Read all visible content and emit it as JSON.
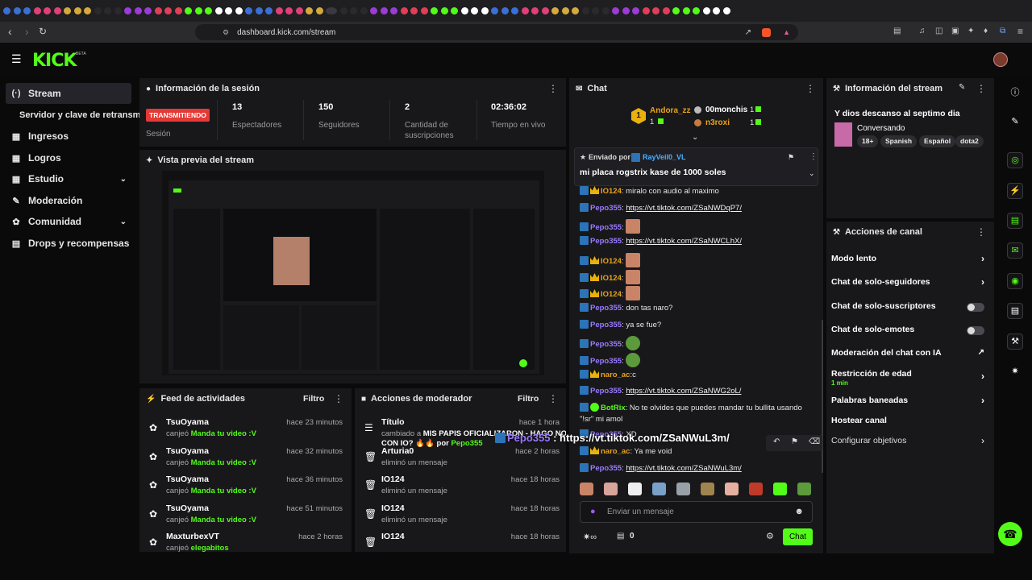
{
  "browser": {
    "url": "dashboard.kick.com/stream",
    "tab_count": 72
  },
  "app": {
    "logo": "KICK",
    "beta": "BETA"
  },
  "sidebar": {
    "items": [
      {
        "label": "Stream",
        "icon": "broadcast-icon",
        "active": true
      },
      {
        "label": "Servidor y clave de retransm",
        "icon": "",
        "sub": true
      },
      {
        "label": "Ingresos",
        "icon": "dollar-icon"
      },
      {
        "label": "Logros",
        "icon": "trophy-icon"
      },
      {
        "label": "Estudio",
        "icon": "studio-icon",
        "expand": true
      },
      {
        "label": "Moderación",
        "icon": "wrench-icon"
      },
      {
        "label": "Comunidad",
        "icon": "community-icon",
        "expand": true
      },
      {
        "label": "Drops y recompensas",
        "icon": "drops-icon"
      }
    ]
  },
  "session": {
    "title": "Información de la sesión",
    "live_badge": "TRANSMITIENDO",
    "live_label": "Sesión",
    "stats": [
      {
        "value": "13",
        "label": "Espectadores"
      },
      {
        "value": "150",
        "label": "Seguidores"
      },
      {
        "value": "2",
        "label": "Cantidad de suscripciones"
      },
      {
        "value": "02:36:02",
        "label": "Tiempo en vivo"
      }
    ]
  },
  "preview": {
    "title": "Vista previa del stream"
  },
  "feed": {
    "title": "Feed de actividades",
    "filter": "Filtro",
    "rows": [
      {
        "user": "TsuOyama",
        "action": "canjeó",
        "reward": "Manda tu video :V",
        "time": "hace 23 minutos"
      },
      {
        "user": "TsuOyama",
        "action": "canjeó",
        "reward": "Manda tu video :V",
        "time": "hace 32 minutos"
      },
      {
        "user": "TsuOyama",
        "action": "canjeó",
        "reward": "Manda tu video :V",
        "time": "hace 36 minutos"
      },
      {
        "user": "TsuOyama",
        "action": "canjeó",
        "reward": "Manda tu video :V",
        "time": "hace 51 minutos"
      },
      {
        "user": "MaxturbexVT",
        "action": "canjeó",
        "reward": "elegabitos",
        "time": "hace 2 horas"
      }
    ]
  },
  "modactions": {
    "title": "Acciones de moderador",
    "filter": "Filtro",
    "rows": [
      {
        "user": "Título",
        "line1": "cambiado a",
        "bold1": "MIS PAPIS OFICIALIZARON - HAGO NOVELA",
        "line2": "CON IO? 🔥🔥 por",
        "by": "Pepo355",
        "time": "hace 1 hora"
      },
      {
        "user": "Arturia0",
        "line1": "eliminó un mensaje",
        "time": "hace 2 horas"
      },
      {
        "user": "IO124",
        "line1": "eliminó un mensaje",
        "time": "hace 18 horas"
      },
      {
        "user": "IO124",
        "line1": "eliminó un mensaje",
        "time": "hace 18 horas"
      },
      {
        "user": "IO124",
        "line1": "",
        "time": "hace 18 horas"
      }
    ]
  },
  "chat": {
    "title": "Chat",
    "leaderboard": {
      "first": {
        "rank": "1",
        "name": "Andora_zz",
        "count": "1"
      },
      "others": [
        {
          "name": "00monchis",
          "count": "1"
        },
        {
          "name": "n3roxi",
          "count": "1"
        }
      ]
    },
    "pinned": {
      "label": "Enviado por",
      "by": "RayVeil0_VL",
      "text": "mi placa rogstrix kase de 1000 soles"
    },
    "messages": [
      {
        "user": "IO124",
        "color": "#e8a21c",
        "badges": [
          "kick",
          "crown"
        ],
        "text": ": miralo con audio al maximo"
      },
      {
        "user": "Pepo355",
        "color": "#9b7bff",
        "badges": [
          "kick"
        ],
        "link": "https://vt.tiktok.com/ZSaNWDqP7/"
      },
      {
        "user": "Pepo355",
        "color": "#9b7bff",
        "badges": [
          "kick"
        ],
        "emote": "face"
      },
      {
        "user": "Pepo355",
        "color": "#9b7bff",
        "badges": [
          "kick"
        ],
        "link": "https://vt.tiktok.com/ZSaNWCLhX/"
      },
      {
        "user": "IO124",
        "color": "#e8a21c",
        "badges": [
          "kick",
          "crown"
        ],
        "emote": "face"
      },
      {
        "user": "IO124",
        "color": "#e8a21c",
        "badges": [
          "kick",
          "crown"
        ],
        "emote": "face"
      },
      {
        "user": "IO124",
        "color": "#e8a21c",
        "badges": [
          "kick",
          "crown"
        ],
        "emote": "face"
      },
      {
        "user": "Pepo355",
        "color": "#9b7bff",
        "badges": [
          "kick"
        ],
        "text": ": don tas naro?"
      },
      {
        "user": "Pepo355",
        "color": "#9b7bff",
        "badges": [
          "kick"
        ],
        "text": ": ya se fue?"
      },
      {
        "user": "Pepo355",
        "color": "#9b7bff",
        "badges": [
          "kick"
        ],
        "emote": "frog"
      },
      {
        "user": "Pepo355",
        "color": "#9b7bff",
        "badges": [
          "kick"
        ],
        "emote": "frog"
      },
      {
        "user": "naro_ac",
        "color": "#e8a21c",
        "badges": [
          "kick",
          "crown"
        ],
        "text": ":c"
      },
      {
        "user": "Pepo355",
        "color": "#9b7bff",
        "badges": [
          "kick"
        ],
        "link": "https://vt.tiktok.com/ZSaNWG2oL/"
      },
      {
        "user": "BotRix",
        "color": "#53fc18",
        "badges": [
          "kick",
          "verified"
        ],
        "text": ": No te olvides que puedes mandar tu bullita usando",
        "text2": "\"!sr\" mi amol"
      },
      {
        "user": "Pepo355",
        "color": "#9b7bff",
        "badges": [
          "kick"
        ],
        "text": ": XD"
      },
      {
        "user": "naro_ac",
        "color": "#e8a21c",
        "badges": [
          "kick",
          "crown"
        ],
        "text": ": Ya me void"
      },
      {
        "user": "Pepo355",
        "color": "#9b7bff",
        "badges": [
          "kick"
        ],
        "link": "https://vt.tiktok.com/ZSaNWuL3m/"
      }
    ],
    "overlay": {
      "user": "Pepo355",
      "link": "https://vt.tiktok.com/ZSaNWuL3m/"
    },
    "input_placeholder": "Enviar un mensaje",
    "points": "0",
    "send": "Chat"
  },
  "streaminfo": {
    "title": "Información del stream",
    "stream_title": "Y dios descanso al septimo dia",
    "category": "Conversando",
    "tags": [
      "18+",
      "Spanish",
      "Español",
      "dota2"
    ]
  },
  "channel": {
    "title": "Acciones de canal",
    "rows": [
      {
        "label": "Modo lento",
        "kind": "arrow"
      },
      {
        "label": "Chat de solo-seguidores",
        "kind": "arrow"
      },
      {
        "label": "Chat de solo-suscriptores",
        "kind": "toggle"
      },
      {
        "label": "Chat de solo-emotes",
        "kind": "toggle"
      },
      {
        "label": "Moderación del chat con IA",
        "kind": "external"
      },
      {
        "label": "Restricción de edad",
        "sub": "1 min",
        "kind": "arrow"
      },
      {
        "label": "Palabras baneadas",
        "kind": "arrow"
      },
      {
        "label": "Hostear canal",
        "kind": "none"
      },
      {
        "label": "Configurar objetivos",
        "kind": "arrow"
      }
    ]
  },
  "colors": {
    "brand": "#53fc18",
    "live": "#e53935",
    "panel": "#18181b"
  }
}
